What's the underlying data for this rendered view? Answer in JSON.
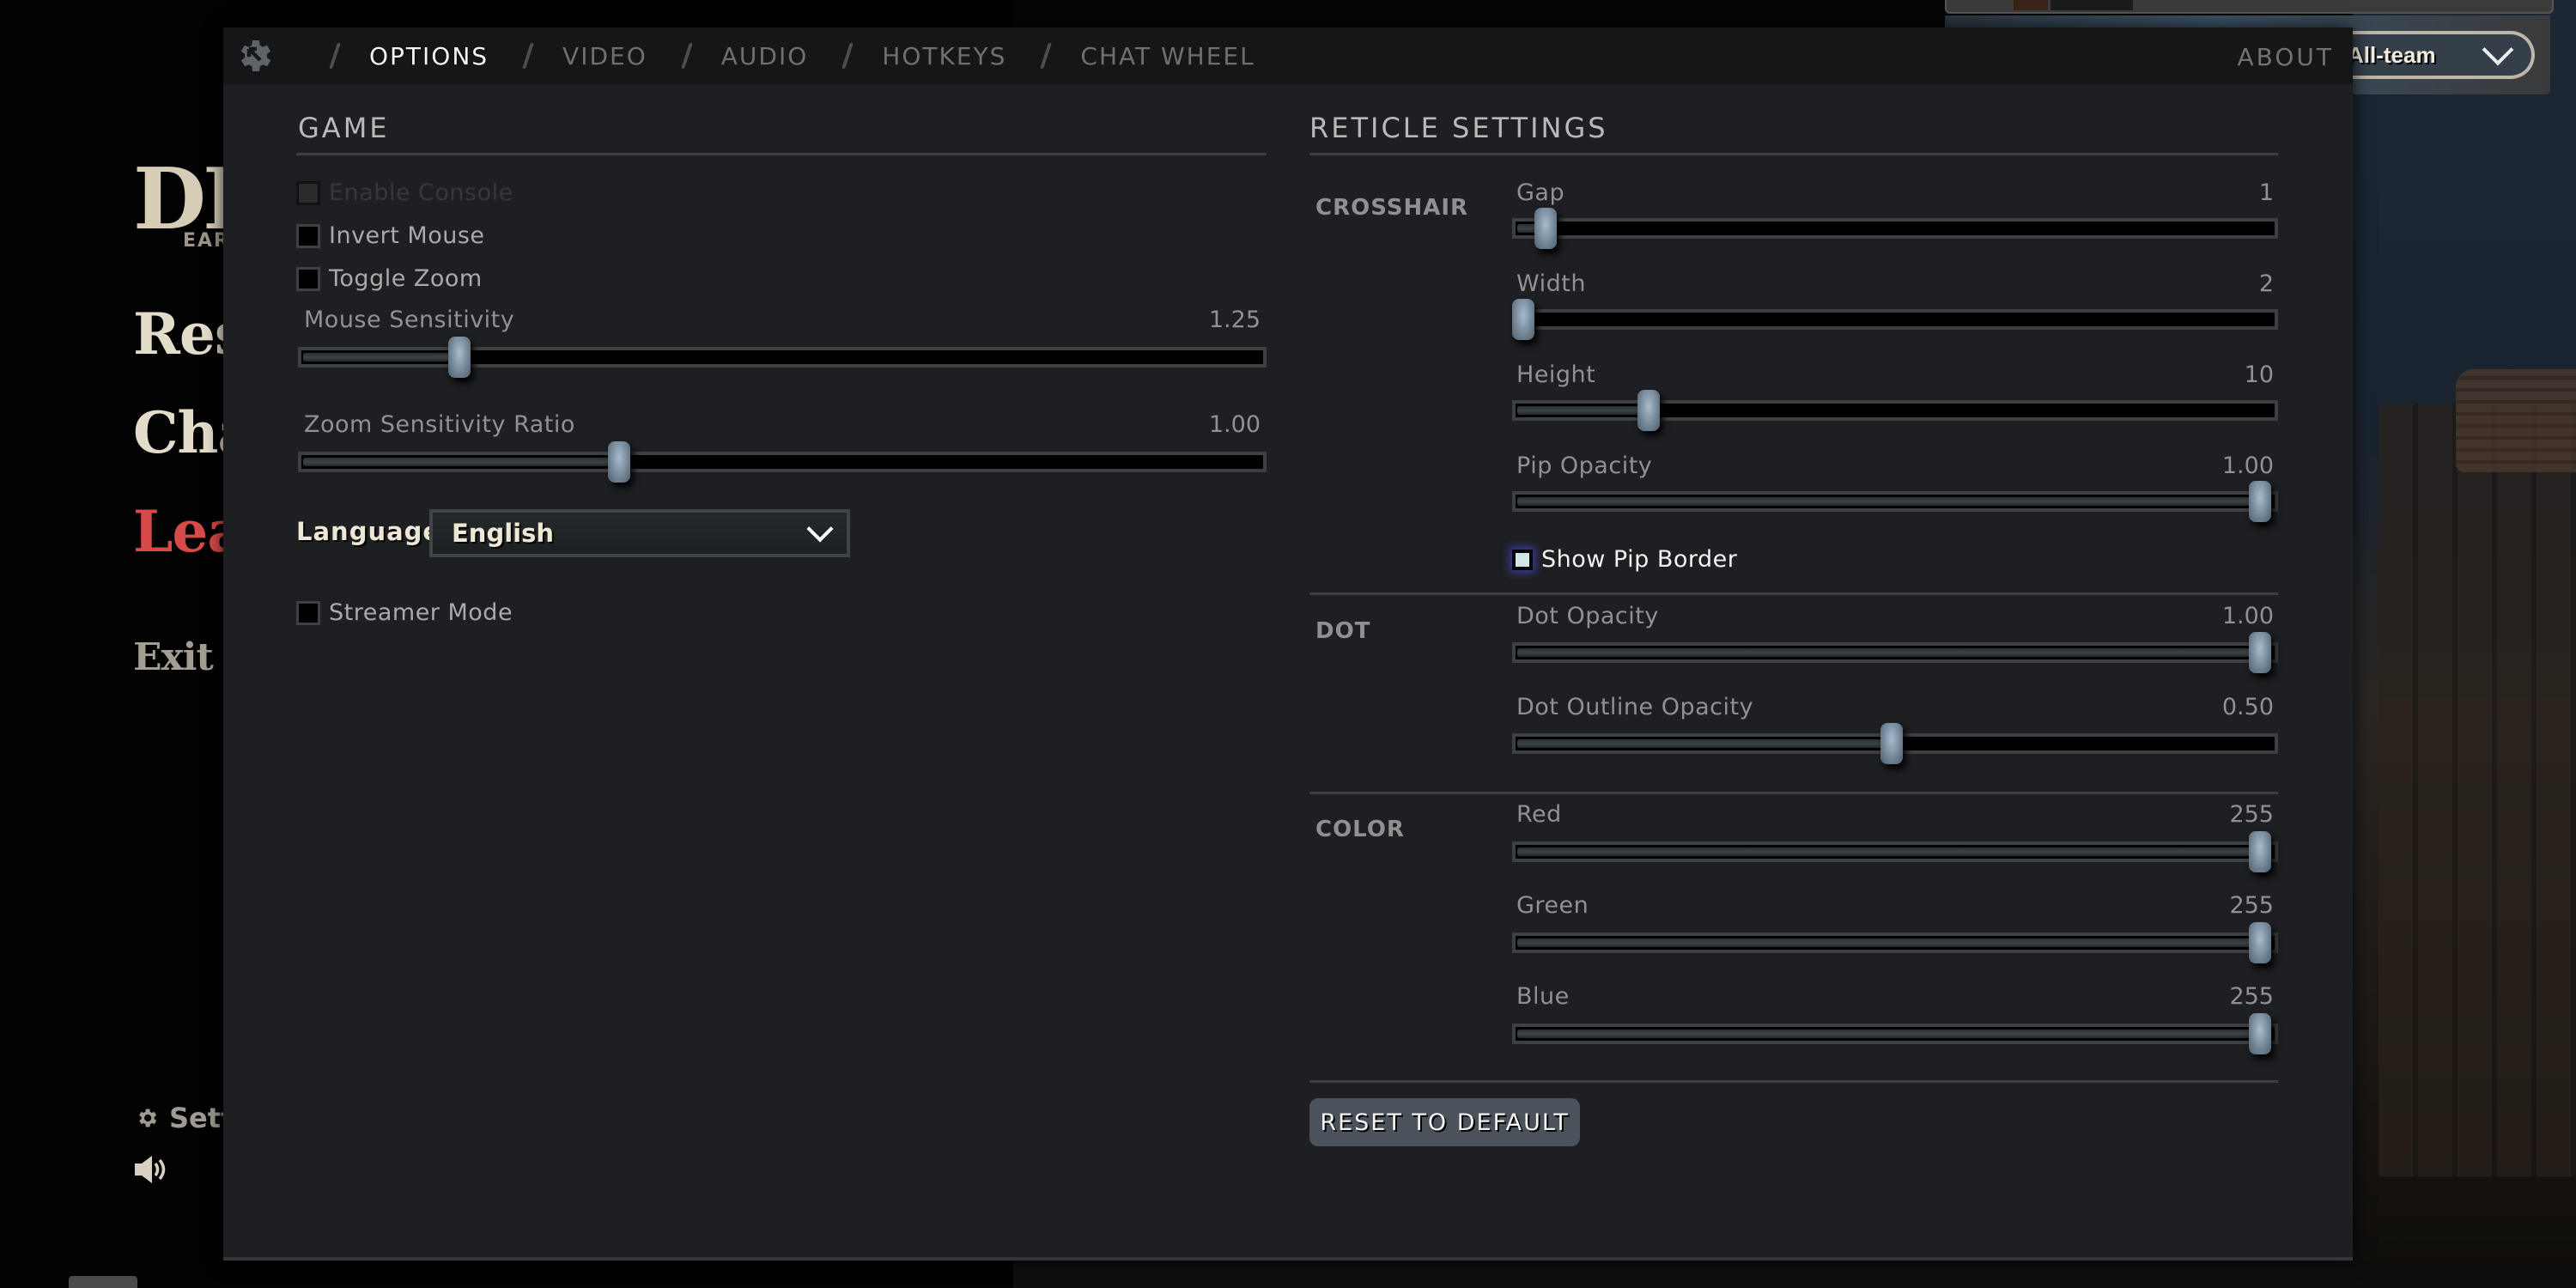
{
  "background_menu": {
    "logo": "DE",
    "logo_subtitle": "EARL",
    "items": [
      {
        "label": "Res",
        "color": "#e4dccb"
      },
      {
        "label": "Cha",
        "color": "#e4dccb"
      },
      {
        "label": "Leav",
        "color": "#d8494a"
      },
      {
        "label": "Exit G",
        "color": "#a39d92"
      }
    ],
    "settings_label": "Sett",
    "chat_channel": "All-team"
  },
  "dialog": {
    "tabs": [
      {
        "label": "OPTIONS",
        "active": true
      },
      {
        "label": "VIDEO",
        "active": false
      },
      {
        "label": "AUDIO",
        "active": false
      },
      {
        "label": "HOTKEYS",
        "active": false
      },
      {
        "label": "CHAT WHEEL",
        "active": false
      }
    ],
    "about_label": "ABOUT",
    "game": {
      "title": "GAME",
      "checkboxes": [
        {
          "label": "Enable Console",
          "checked": false,
          "disabled": true
        },
        {
          "label": "Invert Mouse",
          "checked": false,
          "disabled": false
        },
        {
          "label": "Toggle Zoom",
          "checked": false,
          "disabled": false
        }
      ],
      "sliders": [
        {
          "label": "Mouse Sensitivity",
          "value": "1.25",
          "fraction": 0.16
        },
        {
          "label": "Zoom Sensitivity Ratio",
          "value": "1.00",
          "fraction": 0.33
        }
      ],
      "language_label": "Language:",
      "language_value": "English",
      "streamer_mode": {
        "label": "Streamer Mode",
        "checked": false
      }
    },
    "reticle": {
      "title": "RETICLE SETTINGS",
      "groups": [
        {
          "label": "CROSSHAIR",
          "sliders": [
            {
              "label": "Gap",
              "value": "1",
              "fraction": 0.03
            },
            {
              "label": "Width",
              "value": "2",
              "fraction": 0.0
            },
            {
              "label": "Height",
              "value": "10",
              "fraction": 0.17
            },
            {
              "label": "Pip Opacity",
              "value": "1.00",
              "fraction": 1.0
            }
          ],
          "checkbox": {
            "label": "Show Pip Border",
            "checked": false,
            "focused": true
          }
        },
        {
          "label": "DOT",
          "sliders": [
            {
              "label": "Dot Opacity",
              "value": "1.00",
              "fraction": 1.0
            },
            {
              "label": "Dot Outline Opacity",
              "value": "0.50",
              "fraction": 0.5
            }
          ]
        },
        {
          "label": "COLOR",
          "sliders": [
            {
              "label": "Red",
              "value": "255",
              "fraction": 1.0
            },
            {
              "label": "Green",
              "value": "255",
              "fraction": 1.0
            },
            {
              "label": "Blue",
              "value": "255",
              "fraction": 1.0
            }
          ]
        }
      ],
      "reset_label": "RESET TO DEFAULT"
    }
  }
}
